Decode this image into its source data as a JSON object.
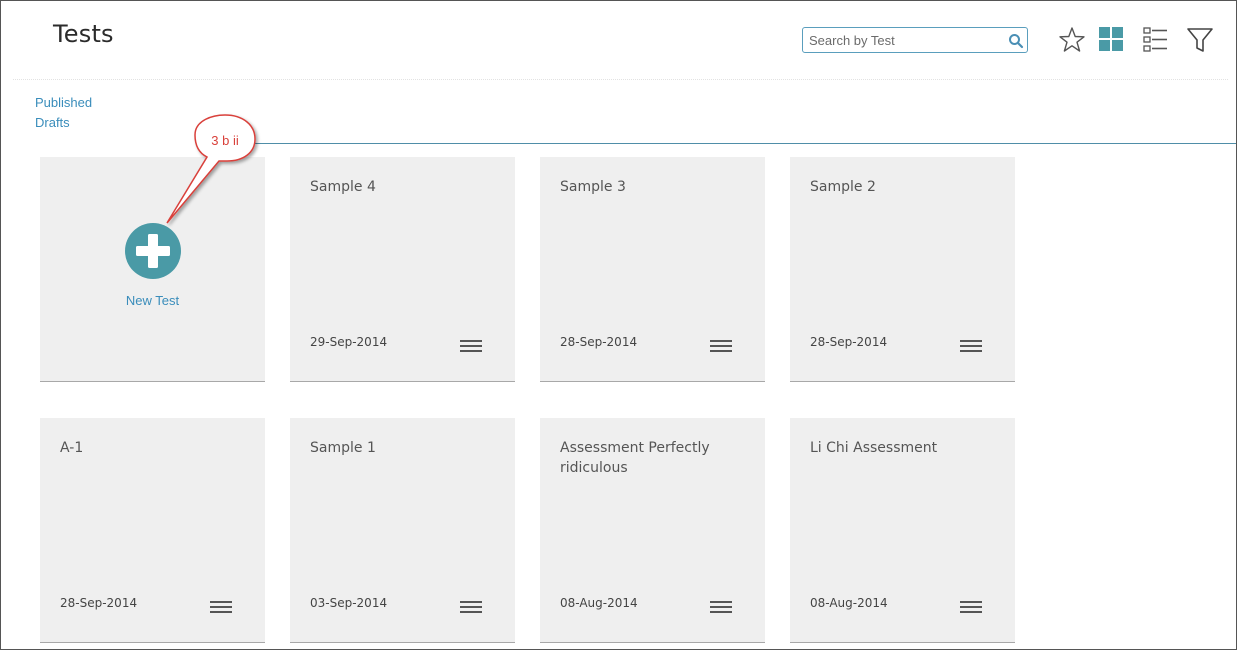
{
  "header": {
    "title": "Tests",
    "search_placeholder": "Search by Test",
    "icons": [
      "star-icon",
      "grid-view-icon",
      "list-view-icon",
      "filter-icon"
    ]
  },
  "nav": {
    "published": "Published",
    "drafts": "Drafts"
  },
  "new_test": {
    "label": "New Test",
    "annotation": "3 b ii"
  },
  "cards": [
    {
      "name": "Sample 4",
      "date": "29-Sep-2014"
    },
    {
      "name": "Sample 3",
      "date": "28-Sep-2014"
    },
    {
      "name": "Sample 2",
      "date": "28-Sep-2014"
    },
    {
      "name": "A-1",
      "date": "28-Sep-2014"
    },
    {
      "name": "Sample 1",
      "date": "03-Sep-2014"
    },
    {
      "name": "Assessment Perfectly ridiculous",
      "date": "08-Aug-2014"
    },
    {
      "name": "Li Chi Assessment",
      "date": "08-Aug-2014"
    }
  ],
  "colors": {
    "accent": "#4a9aa6",
    "link": "#3a8dbb",
    "card_bg": "#efefef",
    "callout": "#d9413b"
  }
}
